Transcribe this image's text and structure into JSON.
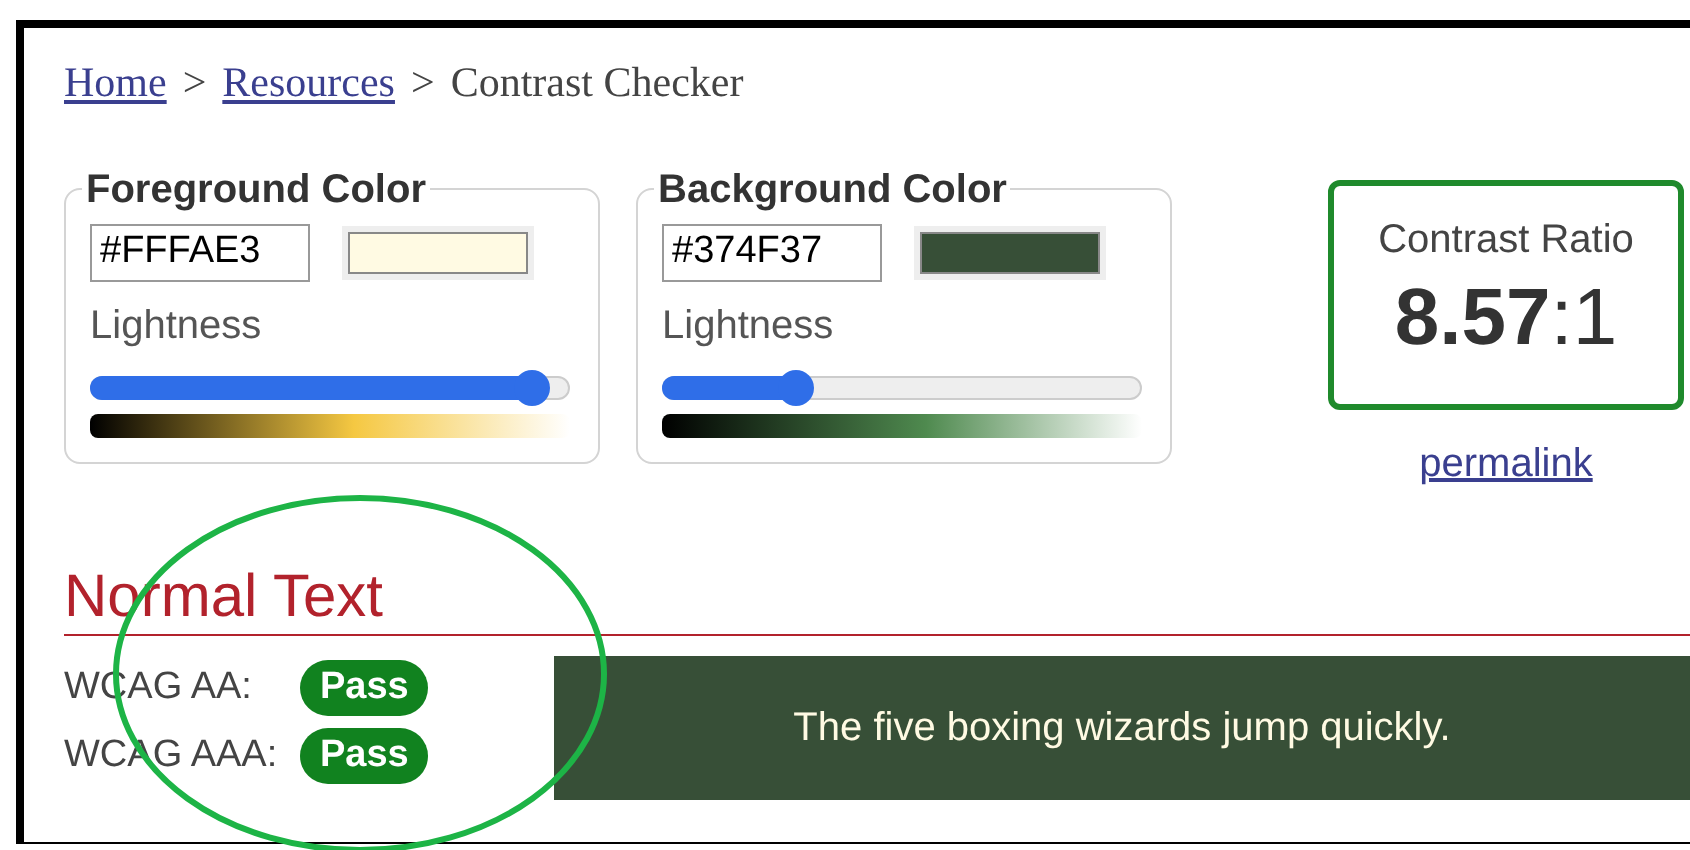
{
  "breadcrumb": [
    {
      "kind": "link",
      "text": "Home"
    },
    {
      "kind": "separator",
      "text": ">"
    },
    {
      "kind": "link",
      "text": "Resources"
    },
    {
      "kind": "separator",
      "text": ">"
    },
    {
      "kind": "current",
      "text": "Contrast Checker"
    }
  ],
  "color_pickers": [
    {
      "legend": "Foreground Color",
      "value": "#FFFAE3",
      "slider_label": "Lightness",
      "level": 0.92,
      "color": "#f5c842"
    },
    {
      "legend": "Background Color",
      "value": "#374F37",
      "slider_label": "Lightness",
      "level": 0.28,
      "color": "#4f8a4f"
    }
  ],
  "contrast": {
    "title": "Contrast Ratio",
    "ratio": "**8.57**:1",
    "permalink": "permalink"
  },
  "normal_text": {
    "heading": "Normal Text",
    "results": [
      {
        "label": "WCAG AA:",
        "result": "Pass",
        "passed": true
      },
      {
        "label": "WCAG AAA:",
        "result": "Pass",
        "passed": true
      }
    ],
    "sample": "The five boxing wizards jump quickly."
  },
  "annotation": {
    "kind": "ellipse"
  }
}
